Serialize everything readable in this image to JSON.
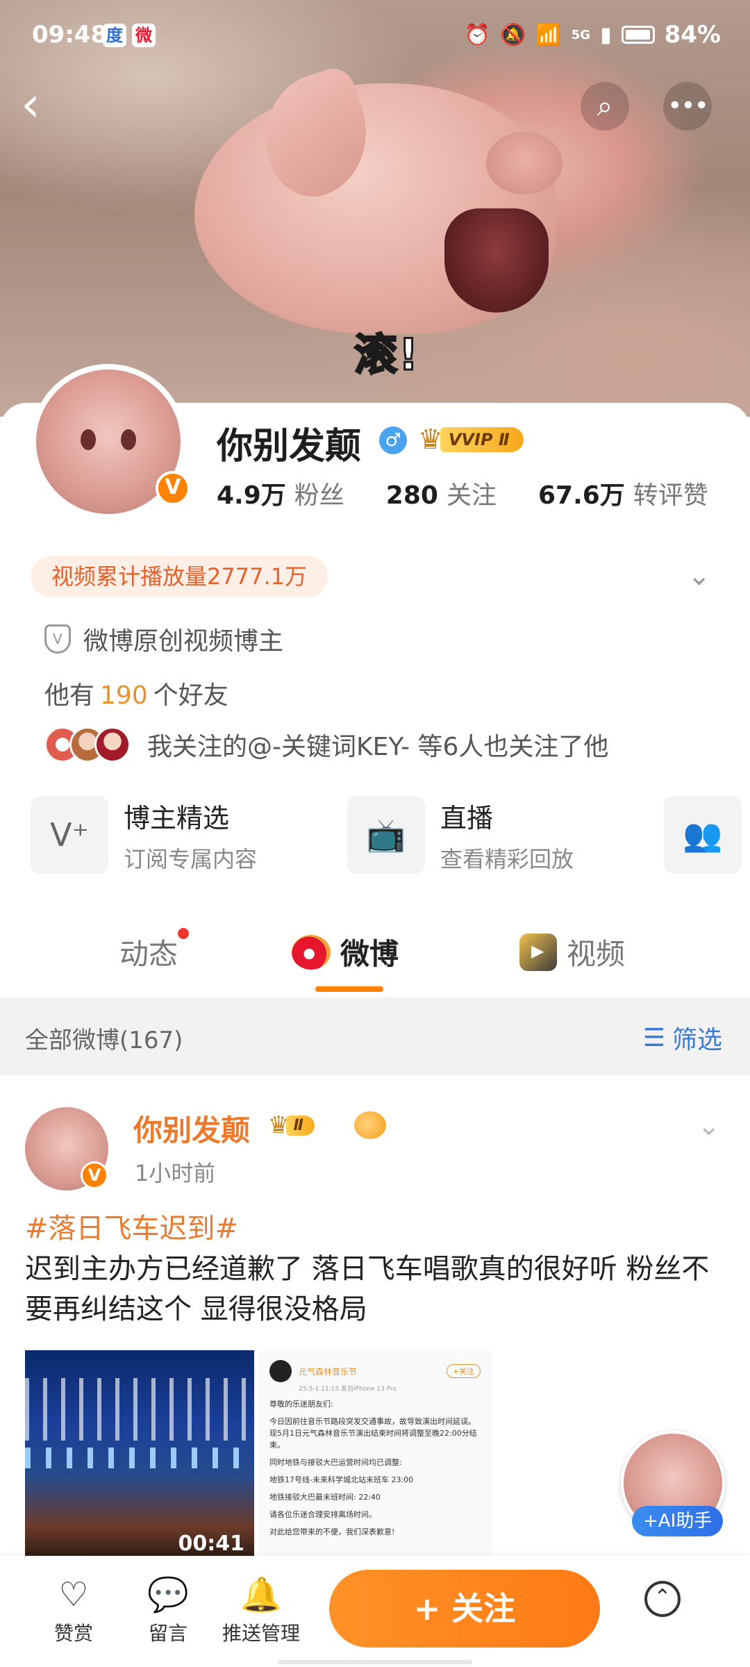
{
  "status_bar": {
    "time": "09:48",
    "battery": "84%",
    "signal_label": "5G"
  },
  "cover": {
    "caption": "滚!"
  },
  "profile": {
    "name": "你别发颠",
    "gender_symbol": "♂",
    "vvip_label": "VVIP Ⅱ",
    "avatar_badge": "V",
    "stats": [
      {
        "value": "4.9万",
        "label": "粉丝"
      },
      {
        "value": "280",
        "label": "关注"
      },
      {
        "value": "67.6万",
        "label": "转评赞"
      }
    ],
    "video_plays": "视频累计播放量2777.1万",
    "certification": "微博原创视频博主",
    "friends_prefix": "他有",
    "friends_count": "190",
    "friends_suffix": "个好友",
    "mutual_text": "我关注的@-关键词KEY- 等6人也关注了他"
  },
  "entries": [
    {
      "title": "博主精选",
      "subtitle": "订阅专属内容",
      "icon": "v-plus-icon"
    },
    {
      "title": "直播",
      "subtitle": "查看精彩回放",
      "icon": "tv-icon"
    }
  ],
  "tabs": [
    {
      "label": "动态",
      "badge": true
    },
    {
      "label": "微博",
      "active": true
    },
    {
      "label": "视频"
    }
  ],
  "filter_bar": {
    "all_label": "全部微博(167)",
    "filter_label": "筛选"
  },
  "post": {
    "author": "你别发颠",
    "vip_label": "Ⅱ",
    "time": "1小时前",
    "topic": "#落日飞车迟到#",
    "text": "迟到主办方已经道歉了 落日飞车唱歌真的很好听 粉丝不要再纠结这个 显得很没格局",
    "video_duration": "00:41",
    "screenshot": {
      "account": "元气森林音乐节",
      "follow": "+关注",
      "meta": "25-5-1 21:15 发自iPhone 13 Pro",
      "lines": [
        "尊敬的乐迷朋友们:",
        "今日因前往音乐节路段突发交通事故，故导致演出时间延误。现5月1日元气森林音乐节演出结束时间将调整至晚22:00分结束。",
        "同时地铁与接驳大巴运营时间均已调整:",
        "地铁17号线-未来科学城北站末班车 23:00",
        "地铁接驳大巴最末班时间: 22:40",
        "请各位乐迷合理安排离场时间。",
        "对此给您带来的不便，我们深表歉意!"
      ]
    }
  },
  "ai_helper": {
    "label": "+AI助手"
  },
  "bottom_bar": {
    "items": [
      {
        "label": "赞赏",
        "icon": "reward-heart-icon"
      },
      {
        "label": "留言",
        "icon": "message-icon"
      },
      {
        "label": "推送管理",
        "icon": "bell-plus-icon"
      }
    ],
    "follow_label": "+ 关注"
  },
  "colors": {
    "accent": "#ff8200",
    "link": "#3a7bd5",
    "name_orange": "#eb7a2c"
  }
}
